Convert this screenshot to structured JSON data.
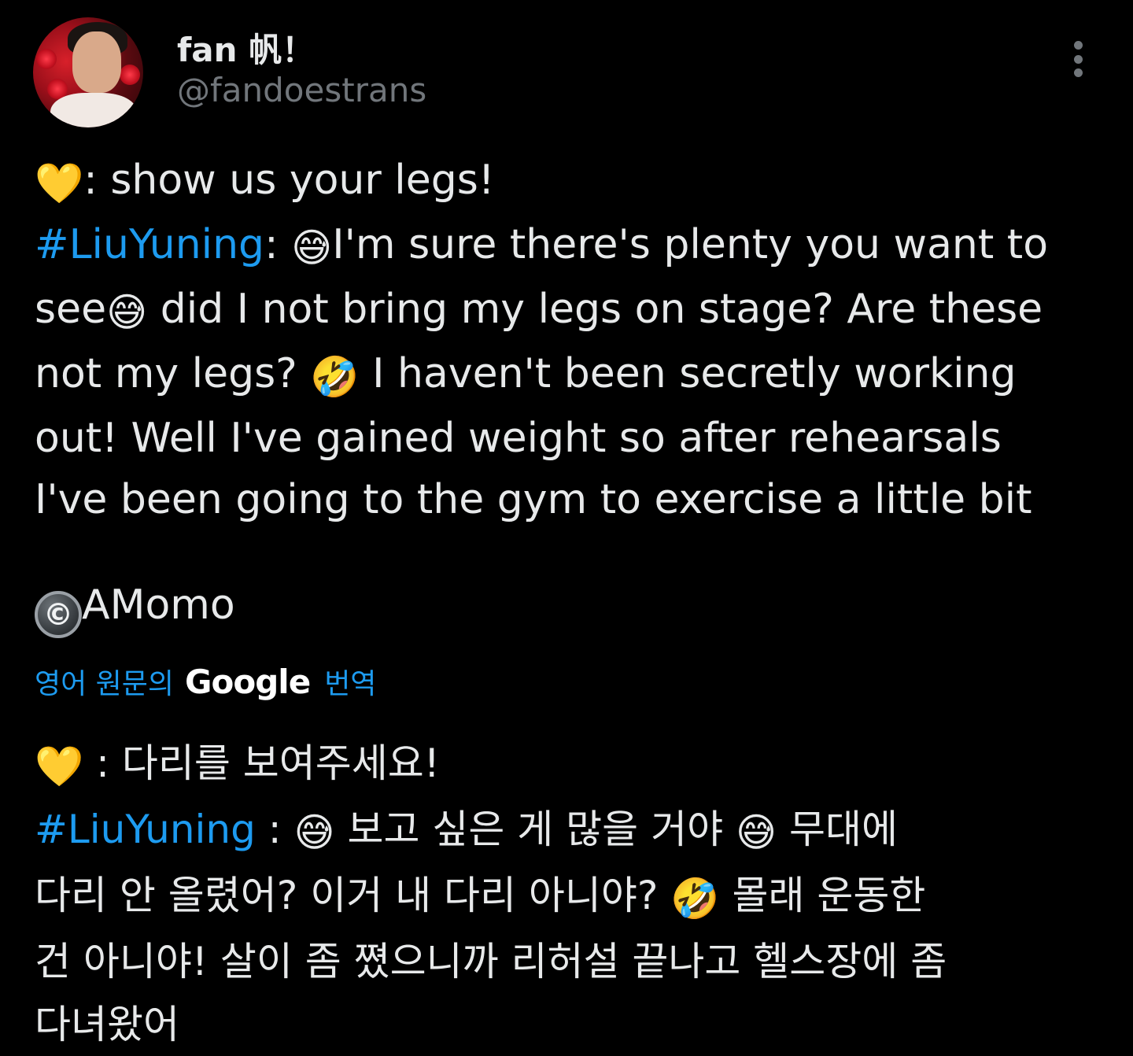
{
  "author": {
    "display_name": "fan 帆！",
    "handle": "@fandoestrans"
  },
  "tweet": {
    "lines": [
      [
        {
          "text": "💛",
          "kind": "emoji"
        },
        {
          "text": ": show us your legs!",
          "kind": "text"
        }
      ],
      [
        {
          "text": "#LiuYuning",
          "kind": "hashtag"
        },
        {
          "text": ": ",
          "kind": "text"
        },
        {
          "text": "😅",
          "kind": "emoji"
        },
        {
          "text": "I'm sure there's plenty you want to",
          "kind": "text"
        }
      ],
      [
        {
          "text": "see",
          "kind": "text"
        },
        {
          "text": "😅",
          "kind": "emoji"
        },
        {
          "text": " did I not bring my legs on stage? Are these",
          "kind": "text"
        }
      ],
      [
        {
          "text": "not my legs? ",
          "kind": "text"
        },
        {
          "text": "🤣",
          "kind": "emoji"
        },
        {
          "text": " I haven't been secretly working",
          "kind": "text"
        }
      ],
      [
        {
          "text": "out! Well I've gained weight so after rehearsals",
          "kind": "text"
        }
      ],
      [
        {
          "text": "I've been going to the gym to exercise a little bit",
          "kind": "text"
        }
      ]
    ],
    "credit_symbol": "©",
    "credit_text": "AMomo"
  },
  "translation": {
    "prefix": "영어 원문의",
    "brand": "Google",
    "suffix": "번역",
    "lines": [
      [
        {
          "text": "💛",
          "kind": "emoji"
        },
        {
          "text": " : 다리를 보여주세요!",
          "kind": "text"
        }
      ],
      [
        {
          "text": "#LiuYuning",
          "kind": "hashtag"
        },
        {
          "text": " : ",
          "kind": "text"
        },
        {
          "text": "😅",
          "kind": "emoji"
        },
        {
          "text": " 보고 싶은 게 많을 거야 ",
          "kind": "text"
        },
        {
          "text": "😅",
          "kind": "emoji"
        },
        {
          "text": " 무대에",
          "kind": "text"
        }
      ],
      [
        {
          "text": "다리 안 올렸어? 이거 내 다리 아니야? ",
          "kind": "text"
        },
        {
          "text": "🤣",
          "kind": "emoji"
        },
        {
          "text": " 몰래 운동한",
          "kind": "text"
        }
      ],
      [
        {
          "text": "건 아니야! 살이 좀 쪘으니까 리허설 끝나고 헬스장에 좀",
          "kind": "text"
        }
      ],
      [
        {
          "text": "다녀왔어",
          "kind": "text"
        }
      ]
    ]
  },
  "colors": {
    "background": "#000000",
    "text": "#e7e9ea",
    "muted": "#71767b",
    "link": "#1d9bf0"
  },
  "icons": {
    "more": "more-vertical-icon",
    "copyright": "copyright-icon"
  }
}
